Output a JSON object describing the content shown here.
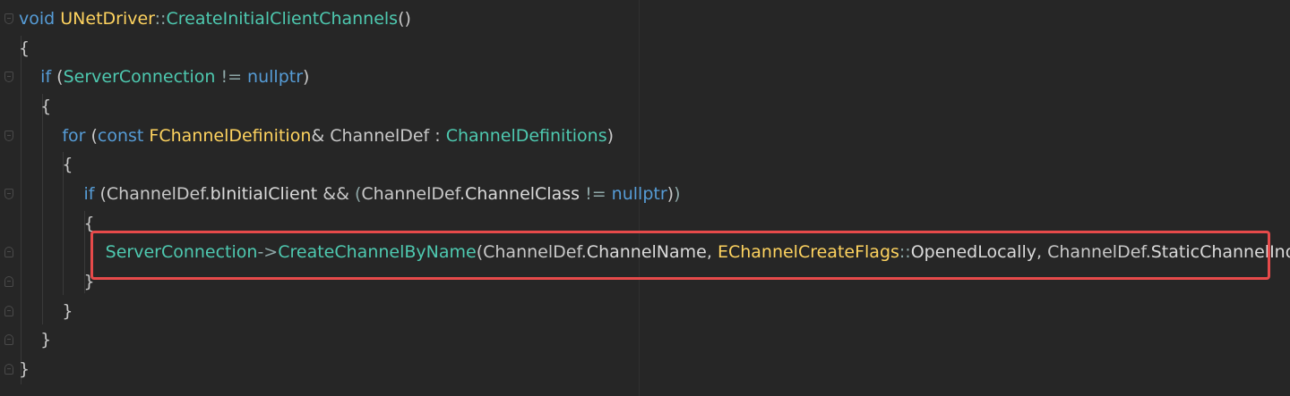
{
  "editor": {
    "lines": [
      {
        "tokens": [
          [
            "kw",
            "void"
          ],
          [
            "txt",
            " "
          ],
          [
            "cls",
            "UNetDriver"
          ],
          [
            "op",
            "::"
          ],
          [
            "fn",
            "CreateInitialClientChannels"
          ],
          [
            "txt",
            "()"
          ]
        ]
      },
      {
        "tokens": [
          [
            "txt",
            "{"
          ]
        ]
      },
      {
        "tokens": [
          [
            "txt",
            "    "
          ],
          [
            "kw",
            "if"
          ],
          [
            "txt",
            " ("
          ],
          [
            "type",
            "ServerConnection"
          ],
          [
            "txt",
            " "
          ],
          [
            "op",
            "!="
          ],
          [
            "txt",
            " "
          ],
          [
            "lit",
            "nullptr"
          ],
          [
            "txt",
            ")"
          ]
        ]
      },
      {
        "tokens": [
          [
            "txt",
            "    {"
          ]
        ]
      },
      {
        "tokens": [
          [
            "txt",
            "        "
          ],
          [
            "kw",
            "for"
          ],
          [
            "txt",
            " ("
          ],
          [
            "kw",
            "const"
          ],
          [
            "txt",
            " "
          ],
          [
            "cls",
            "FChannelDefinition"
          ],
          [
            "txt",
            "& ChannelDef : "
          ],
          [
            "type",
            "ChannelDefinitions"
          ],
          [
            "txt",
            ")"
          ]
        ]
      },
      {
        "tokens": [
          [
            "txt",
            "        {"
          ]
        ]
      },
      {
        "tokens": [
          [
            "txt",
            "            "
          ],
          [
            "kw",
            "if"
          ],
          [
            "txt",
            " (ChannelDef."
          ],
          [
            "member",
            "bInitialClient"
          ],
          [
            "txt",
            " && "
          ],
          [
            "op",
            "("
          ],
          [
            "txt",
            "ChannelDef."
          ],
          [
            "member",
            "ChannelClass"
          ],
          [
            "txt",
            " "
          ],
          [
            "op",
            "!="
          ],
          [
            "txt",
            " "
          ],
          [
            "lit",
            "nullptr"
          ],
          [
            "txt",
            ")"
          ],
          [
            "op",
            ")"
          ]
        ]
      },
      {
        "tokens": [
          [
            "txt",
            "            {"
          ]
        ]
      },
      {
        "tokens": [
          [
            "txt",
            "                "
          ],
          [
            "type",
            "ServerConnection"
          ],
          [
            "op",
            "->"
          ],
          [
            "fn",
            "CreateChannelByName"
          ],
          [
            "txt",
            "(ChannelDef."
          ],
          [
            "member",
            "ChannelName"
          ],
          [
            "txt",
            ", "
          ],
          [
            "cls",
            "EChannelCreateFlags"
          ],
          [
            "op",
            "::"
          ],
          [
            "member",
            "OpenedLocally"
          ],
          [
            "txt",
            ", ChannelDef."
          ],
          [
            "member",
            "StaticChannelIndex"
          ],
          [
            "txt",
            ");"
          ]
        ]
      },
      {
        "tokens": [
          [
            "txt",
            "            }"
          ]
        ]
      },
      {
        "tokens": [
          [
            "txt",
            "        }"
          ]
        ]
      },
      {
        "tokens": [
          [
            "txt",
            "    }"
          ]
        ]
      },
      {
        "tokens": [
          [
            "txt",
            "}"
          ]
        ]
      }
    ]
  },
  "colors": {
    "background": "#262626",
    "keyword": "#569cd6",
    "type": "#4ec9b0",
    "class": "#fed35f",
    "highlight_border": "#e64a4a"
  }
}
